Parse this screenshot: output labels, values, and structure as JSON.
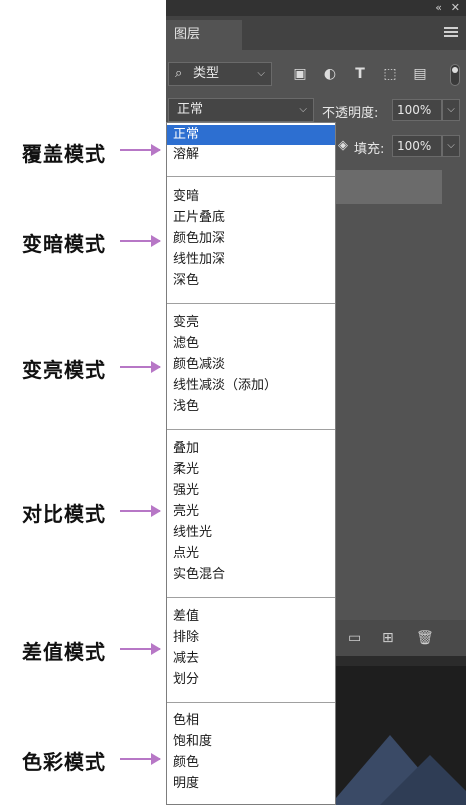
{
  "annotations": [
    {
      "label": "覆盖模式"
    },
    {
      "label": "变暗模式"
    },
    {
      "label": "变亮模式"
    },
    {
      "label": "对比模式"
    },
    {
      "label": "差值模式"
    },
    {
      "label": "色彩模式"
    }
  ],
  "panel": {
    "tab_label": "图层",
    "filter_kind": "类型",
    "blend_mode": "正常",
    "opacity_label": "不透明度:",
    "opacity_value": "100%",
    "fill_label": "填充:",
    "fill_value": "100%"
  },
  "blend_groups": [
    {
      "group": "覆盖模式",
      "items": [
        "正常",
        "溶解"
      ]
    },
    {
      "group": "变暗模式",
      "items": [
        "变暗",
        "正片叠底",
        "颜色加深",
        "线性加深",
        "深色"
      ]
    },
    {
      "group": "变亮模式",
      "items": [
        "变亮",
        "滤色",
        "颜色减淡",
        "线性减淡（添加）",
        "浅色"
      ]
    },
    {
      "group": "对比模式",
      "items": [
        "叠加",
        "柔光",
        "强光",
        "亮光",
        "线性光",
        "点光",
        "实色混合"
      ]
    },
    {
      "group": "差值模式",
      "items": [
        "差值",
        "排除",
        "减去",
        "划分"
      ]
    },
    {
      "group": "色彩模式",
      "items": [
        "色相",
        "饱和度",
        "颜色",
        "明度"
      ]
    }
  ],
  "colors": {
    "arrow": "#b777c6",
    "selection": "#2d6fd1",
    "panel_bg": "#535353"
  }
}
